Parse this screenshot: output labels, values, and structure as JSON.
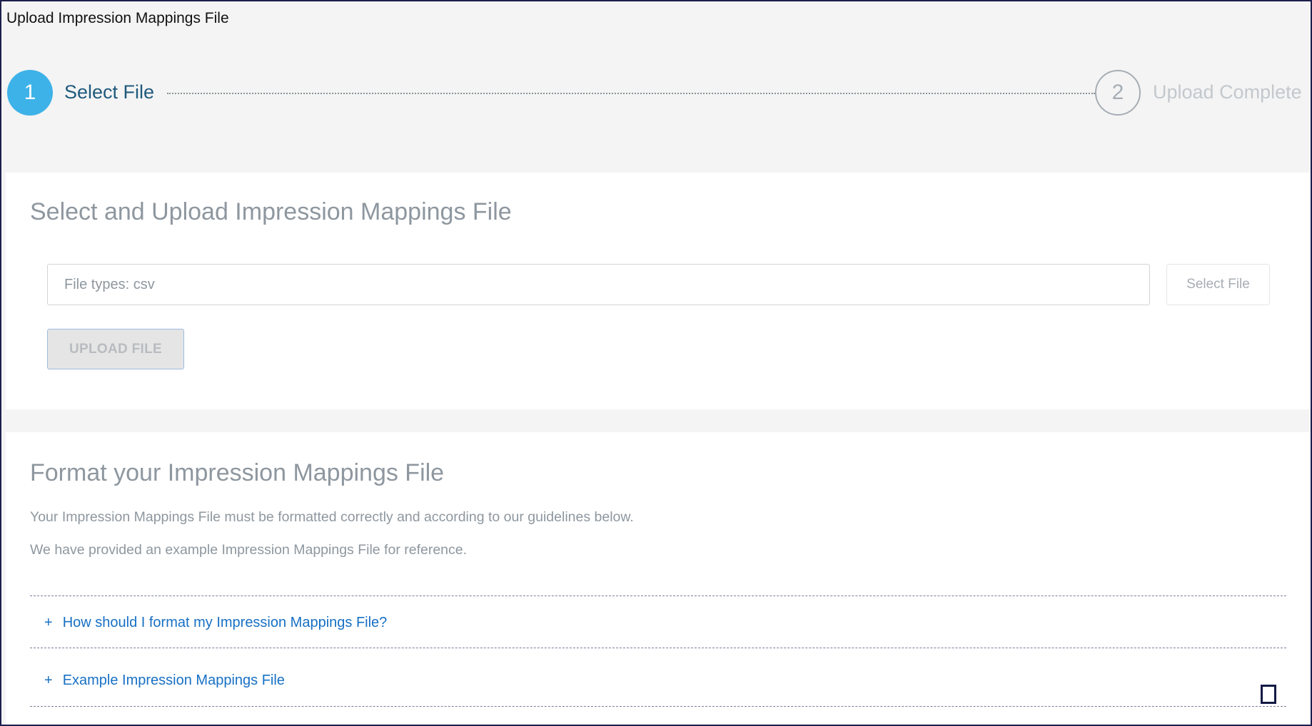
{
  "window": {
    "title": "Upload Impression Mappings File"
  },
  "stepper": {
    "steps": [
      {
        "number": "1",
        "label": "Select File",
        "state": "active"
      },
      {
        "number": "2",
        "label": "Upload Complete",
        "state": "pending"
      }
    ]
  },
  "upload_panel": {
    "heading": "Select and Upload Impression Mappings File",
    "file_input": {
      "placeholder": "File types: csv",
      "value": ""
    },
    "select_file_label": "Select File",
    "upload_button_label": "UPLOAD FILE"
  },
  "format_panel": {
    "heading": "Format your Impression Mappings File",
    "description_1": "Your Impression Mappings File must be formatted correctly and according to our guidelines below.",
    "description_2": "We have provided an example Impression Mappings File for reference.",
    "accordion": [
      {
        "icon": "+",
        "label": "How should I format my Impression Mappings File?"
      },
      {
        "icon": "+",
        "label": "Example Impression Mappings File"
      }
    ]
  },
  "colors": {
    "accent": "#3db2e8",
    "link": "#1770c4",
    "muted_text": "#8e979f",
    "background": "#f4f4f4",
    "frame_border": "#1d1f4e"
  }
}
